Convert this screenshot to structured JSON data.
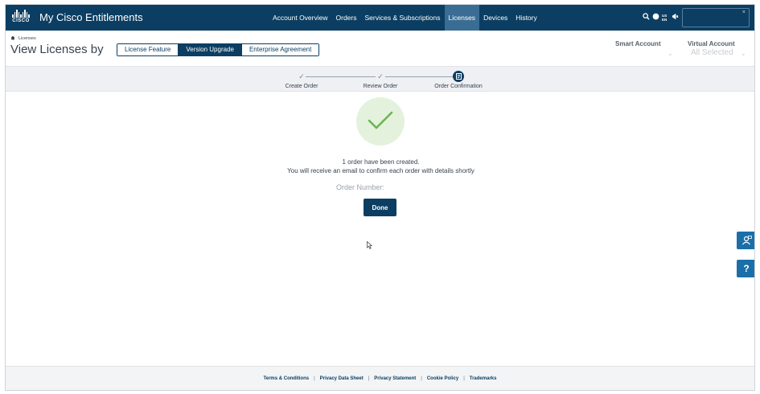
{
  "app": {
    "title": "My Cisco Entitlements",
    "logo_text": "CISCO"
  },
  "nav": {
    "links": [
      {
        "label": "Account Overview",
        "active": false
      },
      {
        "label": "Orders",
        "active": false
      },
      {
        "label": "Services & Subscriptions",
        "active": false
      },
      {
        "label": "Licenses",
        "active": true
      },
      {
        "label": "Devices",
        "active": false
      },
      {
        "label": "History",
        "active": false
      }
    ],
    "icons": [
      "search-icon",
      "globe-icon",
      "language-icon",
      "announcement-icon"
    ],
    "language_code": "US EN"
  },
  "breadcrumb": {
    "home_icon": "home-icon",
    "current": "Licenses"
  },
  "page": {
    "title": "View Licenses by"
  },
  "view_tabs": [
    {
      "label": "License Feature",
      "active": false
    },
    {
      "label": "Version Upgrade",
      "active": true
    },
    {
      "label": "Enterprise Agreement",
      "active": false
    }
  ],
  "accounts": {
    "smart_label": "Smart Account",
    "smart_value": "",
    "virtual_label": "Virtual Account",
    "virtual_value": "All Selected"
  },
  "stepper": {
    "steps": [
      {
        "label": "Create Order",
        "state": "complete"
      },
      {
        "label": "Review Order",
        "state": "complete"
      },
      {
        "label": "Order Confirmation",
        "state": "current"
      }
    ]
  },
  "confirmation": {
    "message_line1": "1 order have been created.",
    "message_line2": "You will receive an email to confirm each order with details shortly",
    "order_number_label": "Order Number:",
    "done_label": "Done",
    "success_color": "#6cb552"
  },
  "floating": {
    "contact_icon": "contact-support-icon",
    "help_label": "?"
  },
  "footer": {
    "links": [
      "Terms & Conditions",
      "Privacy Data Sheet",
      "Privacy Statement",
      "Cookie Policy",
      "Trademarks"
    ]
  },
  "colors": {
    "nav_bg": "#0b3e62",
    "nav_active": "#3a6d93",
    "accent": "#1b6fa8"
  }
}
